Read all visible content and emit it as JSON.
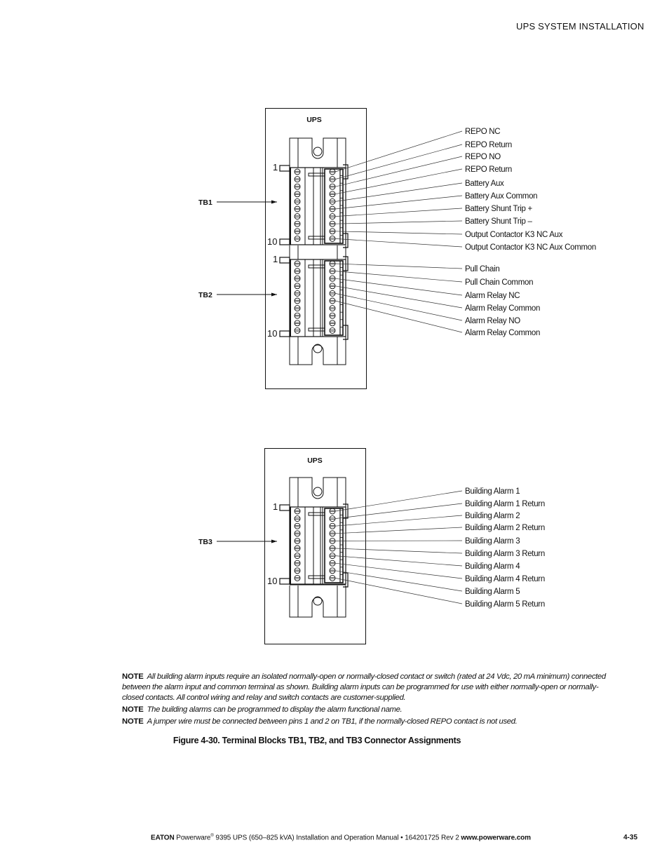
{
  "header": {
    "section_title": "UPS SYSTEM INSTALLATION"
  },
  "figure_top": {
    "panel_label": "UPS",
    "blocks": [
      {
        "name": "TB1",
        "pin_first": "1",
        "pin_last": "10",
        "connections": [
          "REPO NC",
          "REPO Return",
          "REPO NO",
          "REPO Return",
          "Battery Aux",
          "Battery Aux Common",
          "Battery Shunt Trip +",
          "Battery Shunt Trip –",
          "Output Contactor K3 NC Aux",
          "Output Contactor K3 NC Aux Common"
        ]
      },
      {
        "name": "TB2",
        "pin_first": "1",
        "pin_last": "10",
        "connections": [
          "Pull Chain",
          "Pull Chain Common",
          "Alarm Relay NC",
          "Alarm Relay Common",
          "Alarm Relay NO",
          "Alarm Relay Common"
        ]
      }
    ]
  },
  "figure_bottom": {
    "panel_label": "UPS",
    "blocks": [
      {
        "name": "TB3",
        "pin_first": "1",
        "pin_last": "10",
        "connections": [
          "Building Alarm 1",
          "Building Alarm 1 Return",
          "Building Alarm 2",
          "Building Alarm 2 Return",
          "Building Alarm 3",
          "Building Alarm 3 Return",
          "Building Alarm 4",
          "Building Alarm 4 Return",
          "Building Alarm 5",
          "Building Alarm 5 Return"
        ]
      }
    ]
  },
  "notes": [
    {
      "label": "NOTE",
      "text": "All building alarm inputs require an isolated normally-open or normally-closed contact or switch (rated at 24 Vdc, 20 mA minimum) connected between the alarm input and common terminal as shown. Building alarm inputs can be programmed for use with either normally-open or normally-closed contacts. All control wiring and relay and switch contacts are customer-supplied."
    },
    {
      "label": "NOTE",
      "text": "The building alarms can be programmed to display the alarm functional name."
    },
    {
      "label": "NOTE",
      "text": "A jumper wire must be connected between pins 1 and 2 on TB1, if the normally-closed REPO contact is not used."
    }
  ],
  "caption": {
    "number": "Figure 4-30.",
    "title": "Terminal Blocks TB1, TB2, and TB3 Connector Assignments"
  },
  "footer": {
    "brand": "EATON",
    "product": "Powerware",
    "registered": "®",
    "description": " 9395 UPS (650–825 kVA) Installation and Operation Manual  •  164201725 Rev 2 ",
    "website": "www.powerware.com",
    "page_number": "4-35"
  }
}
